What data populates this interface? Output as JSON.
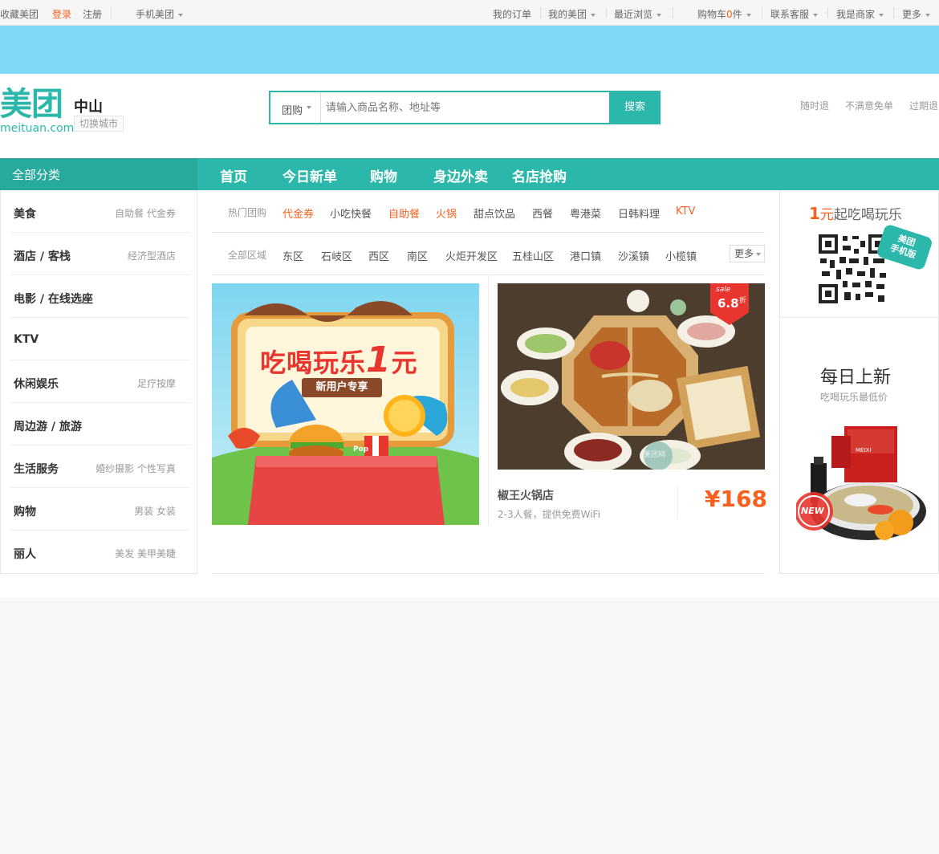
{
  "topbar": {
    "favorite": "收藏美团",
    "login": "登录",
    "register": "注册",
    "mobile": "手机美团",
    "orders": "我的订单",
    "my_meituan": "我的美团",
    "recent": "最近浏览",
    "cart_prefix": "购物车",
    "cart_count": "0",
    "cart_suffix": "件",
    "support": "联系客服",
    "merchant": "我是商家",
    "more": "更多"
  },
  "header": {
    "logo_cn": "美团",
    "logo_en": "meituan.com",
    "city": "中山",
    "switch_city": "切换城市",
    "search_category": "团购",
    "search_placeholder": "请输入商品名称、地址等",
    "search_button": "搜索",
    "guarantees": [
      "随时退",
      "不满意免单",
      "过期退"
    ]
  },
  "nav": {
    "all_categories": "全部分类",
    "items": [
      "首页",
      "今日新单",
      "购物",
      "身边外卖",
      "名店抢购"
    ]
  },
  "sidebar": {
    "items": [
      {
        "name": "美食",
        "subs": "自助餐  代金券"
      },
      {
        "name": "酒店 / 客栈",
        "subs": "经济型酒店"
      },
      {
        "name": "电影 / 在线选座",
        "subs": ""
      },
      {
        "name": "KTV",
        "subs": ""
      },
      {
        "name": "休闲娱乐",
        "subs": "足疗按摩"
      },
      {
        "name": "周边游 / 旅游",
        "subs": ""
      },
      {
        "name": "生活服务",
        "subs": "婚纱摄影  个性写真"
      },
      {
        "name": "购物",
        "subs": "男装  女装"
      },
      {
        "name": "丽人",
        "subs": "美发  美甲美睫"
      }
    ]
  },
  "filters": {
    "hot_label": "热门团购",
    "hot_items": [
      "代金券",
      "小吃快餐",
      "自助餐",
      "火锅",
      "甜点饮品",
      "西餐",
      "粤港菜",
      "日韩料理",
      "KTV"
    ],
    "area_label": "全部区域",
    "area_items": [
      "东区",
      "石岐区",
      "西区",
      "南区",
      "火炬开发区",
      "五桂山区",
      "港口镇",
      "沙溪镇",
      "小榄镇"
    ],
    "more": "更多"
  },
  "promo": {
    "title_main": "吃喝玩乐",
    "title_num": "1",
    "title_unit": "元",
    "ribbon": "新用户专享",
    "box_text": "Pop"
  },
  "deal": {
    "sale_label": "sale",
    "sale_value": "6.8",
    "sale_unit": "折",
    "name": "椒王火锅店",
    "desc": "2-3人餐，提供免费WiFi",
    "price": "¥168",
    "watermark": "美团网"
  },
  "right_panel": {
    "qr_num": "1",
    "qr_unit": "元",
    "qr_title_rest": "起吃喝玩乐",
    "qr_badge_line1": "美团",
    "qr_badge_line2": "手机版",
    "daily_title": "每日上新",
    "daily_sub": "吃喝玩乐最低价",
    "new_badge": "NEW",
    "product_label": "MEIXI"
  },
  "colors": {
    "brand": "#2bb8aa",
    "accent": "#f76120",
    "banner": "#82d9f6"
  }
}
